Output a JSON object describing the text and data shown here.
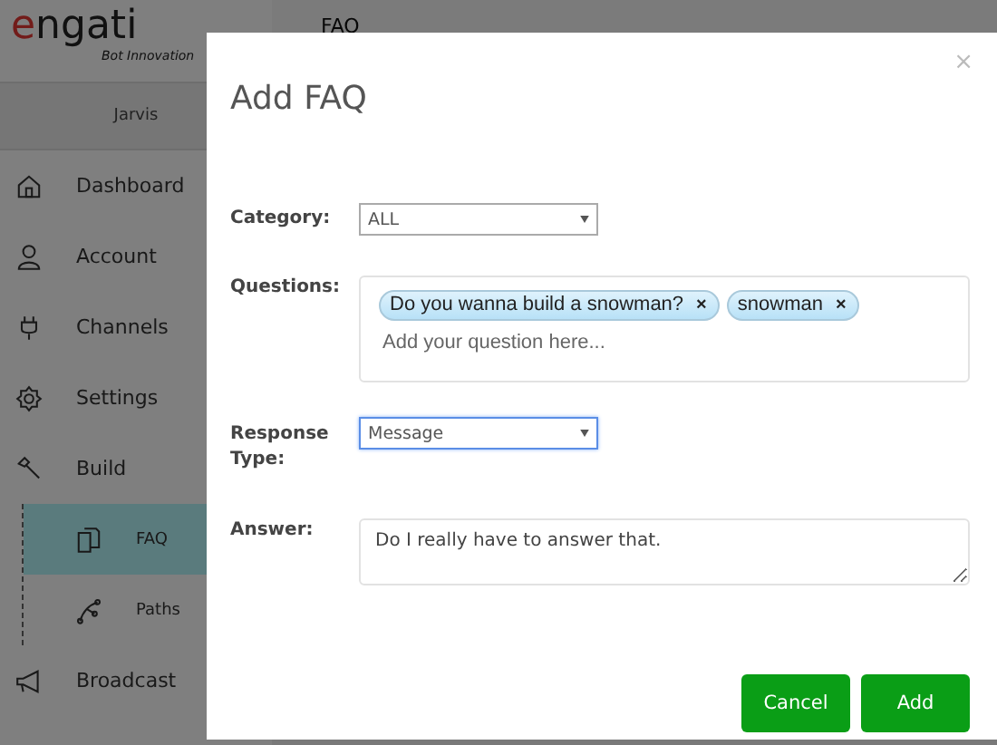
{
  "logo": {
    "text": "engati",
    "tagline": "Bot Innovation"
  },
  "bot_name": "Jarvis",
  "sidebar": {
    "items": [
      {
        "label": "Dashboard",
        "selected": false
      },
      {
        "label": "Account",
        "selected": false
      },
      {
        "label": "Channels",
        "selected": false
      },
      {
        "label": "Settings",
        "selected": false
      },
      {
        "label": "Build",
        "selected": false,
        "children": [
          {
            "label": "FAQ",
            "selected": true
          },
          {
            "label": "Paths",
            "selected": false
          }
        ]
      },
      {
        "label": "Broadcast",
        "selected": false
      }
    ]
  },
  "page_title": "FAQ",
  "dialog": {
    "title": "Add FAQ",
    "close": "×",
    "category": {
      "label": "Category:",
      "value": "ALL"
    },
    "questions": {
      "label": "Questions:",
      "tags": [
        {
          "text": "Do you wanna build a snowman?",
          "remove": "×"
        },
        {
          "text": "snowman",
          "remove": "×"
        }
      ],
      "placeholder": "Add your question here..."
    },
    "response_type": {
      "label": "Response Type:",
      "value": "Message",
      "focused": true
    },
    "answer": {
      "label": "Answer:",
      "value": "Do I really have to answer that."
    },
    "buttons": [
      "Cancel",
      "Add"
    ]
  }
}
